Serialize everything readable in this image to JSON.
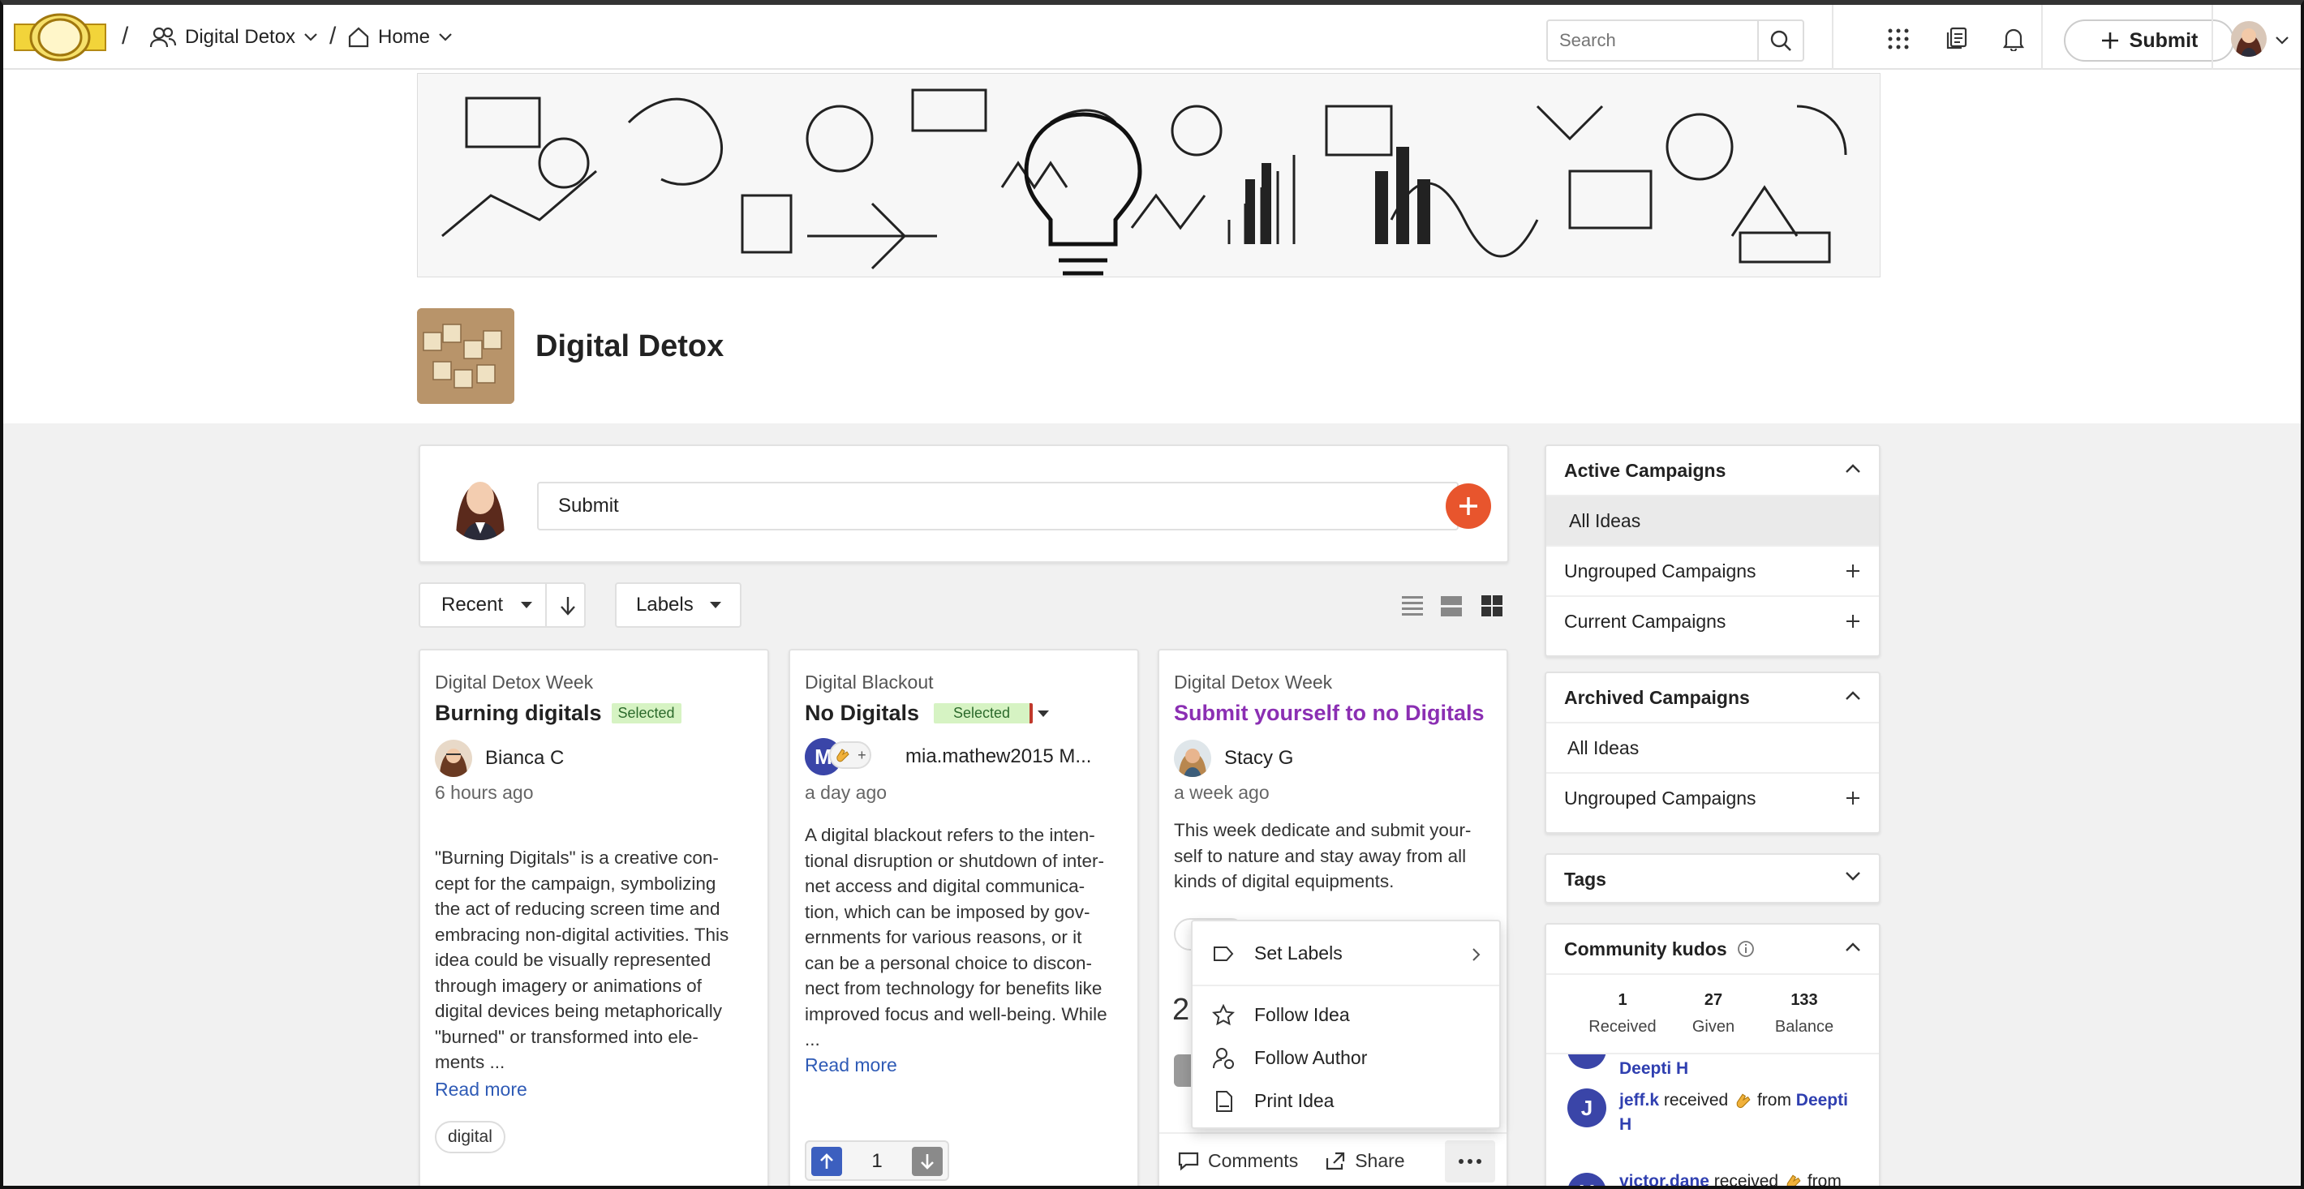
{
  "nav": {
    "breadcrumb_community": "Digital Detox",
    "breadcrumb_page": "Home",
    "search_placeholder": "Search",
    "submit_label": "Submit"
  },
  "community": {
    "title": "Digital Detox"
  },
  "submit_box": {
    "input_text": "Submit"
  },
  "filters": {
    "sort_label": "Recent",
    "labels_label": "Labels"
  },
  "cards": [
    {
      "campaign": "Digital Detox Week",
      "title": "Burning digitals",
      "badge": "Selected",
      "author": "Bianca C",
      "time": "6 hours ago",
      "body_lines": [
        "\"Burning Digitals\" is a creative con-",
        "cept for the campaign, symbolizing",
        "the act of reducing screen time and",
        "embracing non-digital activities. This",
        "idea could be visually represented",
        "through imagery or animations of",
        "digital devices being metaphorically",
        "\"burned\" or transformed into ele-",
        "ments ..."
      ],
      "read_more": "Read more",
      "tag": "digital"
    },
    {
      "campaign": "Digital Blackout",
      "title": "No Digitals",
      "badge": "Selected",
      "author_initial": "M",
      "author": "mia.mathew2015 M...",
      "time": "a day ago",
      "body_lines": [
        "A digital blackout refers to the inten-",
        "tional disruption or shutdown of inter-",
        "net access and digital communica-",
        "tion, which can be imposed by gov-",
        "ernments for various reasons, or it",
        "can be a personal choice to discon-",
        "nect from technology for benefits like",
        "improved focus and well-being. While",
        "..."
      ],
      "read_more": "Read more",
      "vote_count": "1"
    },
    {
      "campaign": "Digital Detox Week",
      "title": "Submit yourself to no Digitals",
      "author": "Stacy G",
      "time": "a week ago",
      "body_lines": [
        "This week dedicate and submit your-",
        "self to nature and stay away from all",
        "kinds of digital equipments."
      ],
      "partial_count": "2",
      "comments_label": "Comments",
      "share_label": "Share"
    }
  ],
  "context_menu": {
    "set_labels": "Set Labels",
    "follow_idea": "Follow Idea",
    "follow_author": "Follow Author",
    "print_idea": "Print Idea"
  },
  "sidebar": {
    "active_campaigns": {
      "title": "Active Campaigns",
      "items": [
        "All Ideas",
        "Ungrouped Campaigns",
        "Current Campaigns"
      ]
    },
    "archived_campaigns": {
      "title": "Archived Campaigns",
      "items": [
        "All Ideas",
        "Ungrouped Campaigns"
      ]
    },
    "tags": {
      "title": "Tags"
    },
    "kudos": {
      "title": "Community kudos",
      "received_value": "1",
      "received_label": "Received",
      "given_value": "27",
      "given_label": "Given",
      "balance_value": "133",
      "balance_label": "Balance",
      "entries": [
        {
          "initial": "",
          "receiver": "",
          "giver": "Deepti H"
        },
        {
          "initial": "J",
          "receiver": "jeff.k",
          "verb": "received",
          "from": "from",
          "giver": "Deepti H"
        },
        {
          "initial": "V",
          "receiver": "victor.dane",
          "verb": "received",
          "from": "from"
        }
      ]
    }
  },
  "colors": {
    "accent_orange": "#e8552d",
    "link_blue": "#2f5bb6",
    "title_purple": "#8b2fb3",
    "vote_blue": "#3c5fbf",
    "badge_green": "#d6f3c3"
  }
}
